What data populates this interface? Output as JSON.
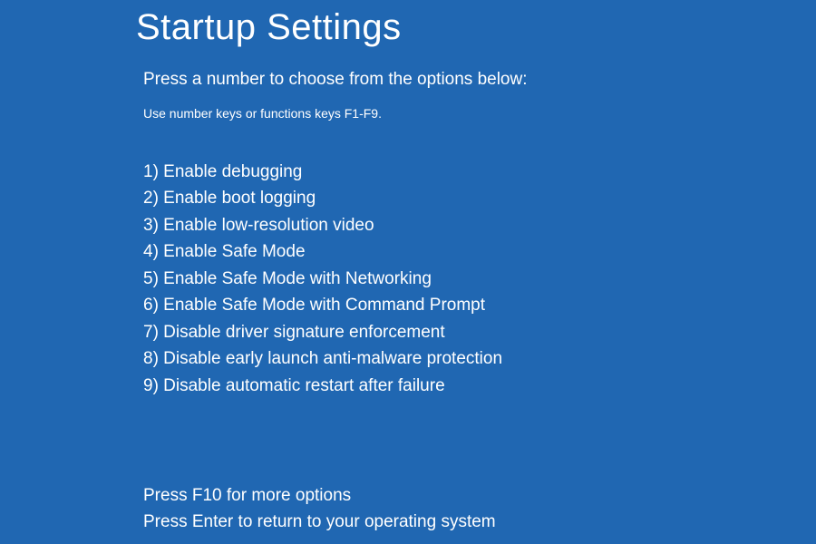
{
  "title": "Startup Settings",
  "subtitle": "Press a number to choose from the options below:",
  "hint": "Use number keys or functions keys F1-F9.",
  "options": [
    "1) Enable debugging",
    "2) Enable boot logging",
    "3) Enable low-resolution video",
    "4) Enable Safe Mode",
    "5) Enable Safe Mode with Networking",
    "6) Enable Safe Mode with Command Prompt",
    "7) Disable driver signature enforcement",
    "8) Disable early launch anti-malware protection",
    "9) Disable automatic restart after failure"
  ],
  "footer": {
    "more": "Press F10 for more options",
    "return": "Press Enter to return to your operating system"
  }
}
